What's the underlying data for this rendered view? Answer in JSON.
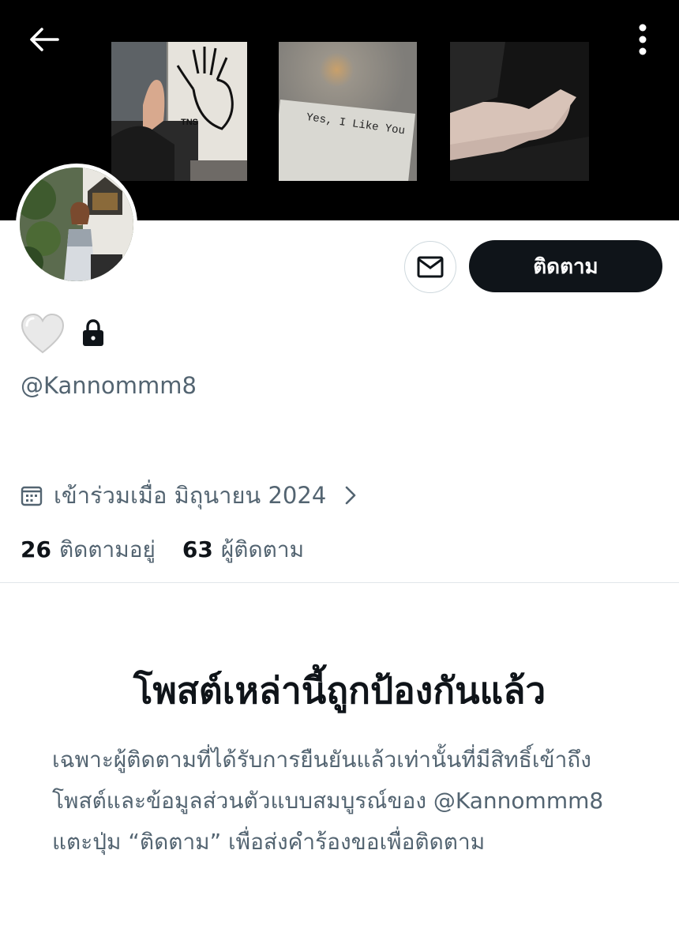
{
  "header": {
    "back_icon": "arrow-left-icon",
    "more_icon": "more-vertical-icon"
  },
  "banner": {
    "photo2_text": "Yes, I Like You",
    "photo1_text": "TNS"
  },
  "actions": {
    "message_icon": "mail-icon",
    "follow_label": "ติดตาม"
  },
  "profile": {
    "name_emoji": "🤍",
    "protected_icon": "lock-icon",
    "handle": "@Kannommm8",
    "joined": "เข้าร่วมเมื่อ มิถุนายน 2024"
  },
  "stats": {
    "following_count": "26",
    "following_label": "ติดตามอยู่",
    "followers_count": "63",
    "followers_label": "ผู้ติดตาม"
  },
  "protected": {
    "title": "โพสต์เหล่านี้ถูกป้องกันแล้ว",
    "description": "เฉพาะผู้ติดตามที่ได้รับการยืนยันแล้วเท่านั้นที่มีสิทธิ์เข้าถึงโพสต์และข้อมูลส่วนตัวแบบสมบูรณ์ของ @Kannommm8 แตะปุ่ม “ติดตาม” เพื่อส่งคำร้องขอเพื่อติดตาม"
  },
  "colors": {
    "text_primary": "#0f1419",
    "text_secondary": "#536471",
    "follow_bg": "#0f1419",
    "border": "#cfd9de"
  }
}
